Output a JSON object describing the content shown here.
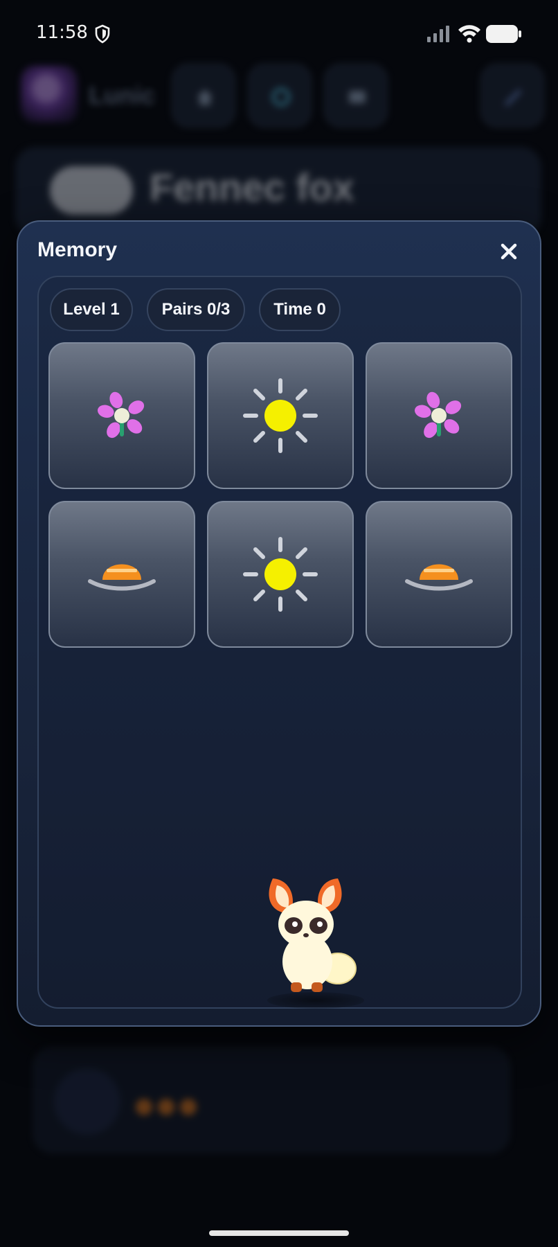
{
  "status_bar": {
    "time": "11:58",
    "icons": [
      "shield-icon",
      "signal-icon",
      "wifi-icon",
      "battery-icon"
    ]
  },
  "background_app": {
    "app_name": "Lunic",
    "nav_icons": [
      "home-icon",
      "color-wheel-icon",
      "card-icon",
      "brush-icon"
    ],
    "pet_name": "Fennec fox"
  },
  "memory_dialog": {
    "title": "Memory",
    "close_icon": "close-icon",
    "stats": {
      "level": "Level 1",
      "pairs": "Pairs 0/3",
      "time": "Time 0"
    },
    "cards": [
      {
        "symbol": "flower-icon",
        "revealed": true
      },
      {
        "symbol": "sun-icon",
        "revealed": true
      },
      {
        "symbol": "flower-icon",
        "revealed": true
      },
      {
        "symbol": "hat-icon",
        "revealed": true
      },
      {
        "symbol": "sun-icon",
        "revealed": true
      },
      {
        "symbol": "hat-icon",
        "revealed": true
      }
    ],
    "mascot": "fennec-fox-icon"
  },
  "colors": {
    "dialog_bg": "#1a2740",
    "dialog_border": "#4a5d7d",
    "pill_bg": "#1a2438",
    "flower_petal": "#e070e8",
    "sun_yellow": "#f5f000",
    "hat_orange": "#f5901e",
    "fox_ears": "#f06a28"
  }
}
